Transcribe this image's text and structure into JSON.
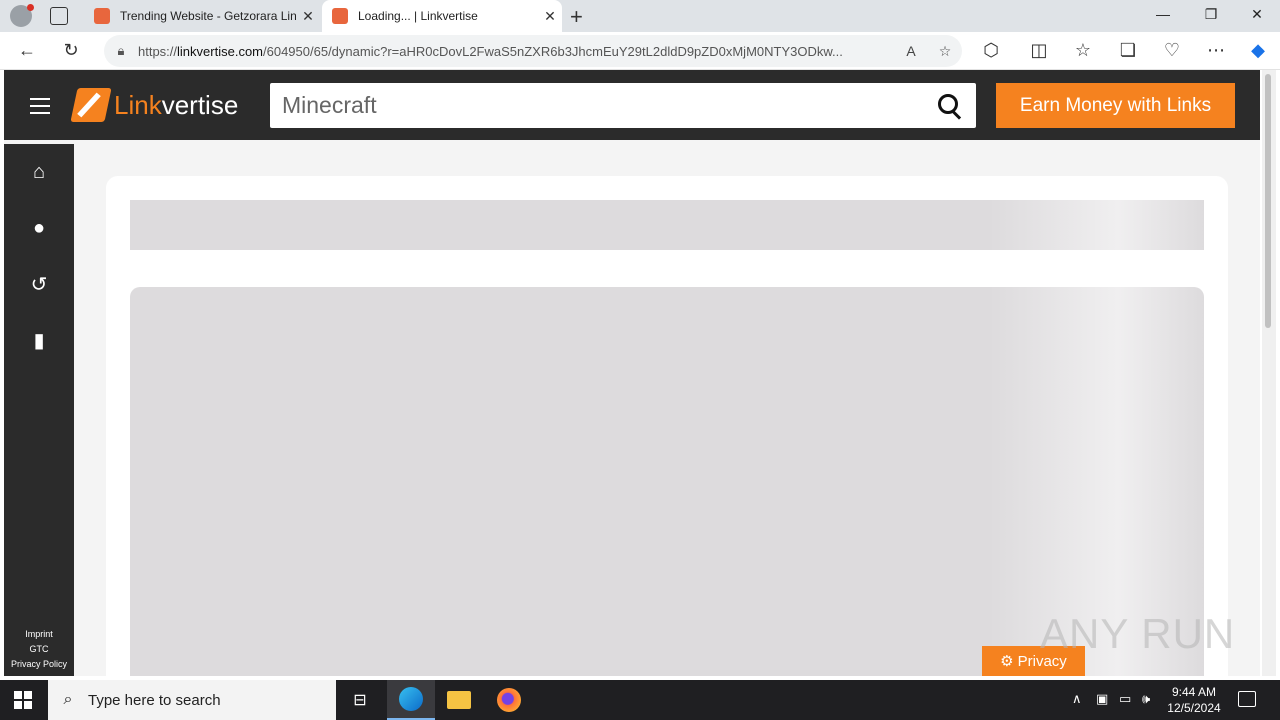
{
  "browser": {
    "tabs": [
      {
        "title": "Trending Website - Getzorara Lin",
        "active": false
      },
      {
        "title": "Loading... | Linkvertise",
        "active": true
      }
    ],
    "new_tab_glyph": "+",
    "close_glyph": "✕",
    "url_prefix": "https://",
    "url_host": "linkvertise.com",
    "url_rest": "/604950/65/dynamic?r=aHR0cDovL2FwaS5nZXR6b3JhcmEuY29tL2dldD9pZD0xMjM0NTY3ODkw..."
  },
  "site": {
    "logo_part1": "Link",
    "logo_part2": "vertise",
    "search_value": "Minecraft",
    "earn_button": "Earn Money with Links",
    "sidebar_footer": {
      "imprint": "Imprint",
      "gtc": "GTC",
      "privacy_policy": "Privacy Policy"
    },
    "privacy_button": "Privacy",
    "watermark": "ANY RUN"
  },
  "taskbar": {
    "search_placeholder": "Type here to search",
    "time": "9:44 AM",
    "date": "12/5/2024"
  },
  "colors": {
    "accent": "#f5821f",
    "header": "#2b2b2b",
    "skeleton": "#dddbdd"
  }
}
